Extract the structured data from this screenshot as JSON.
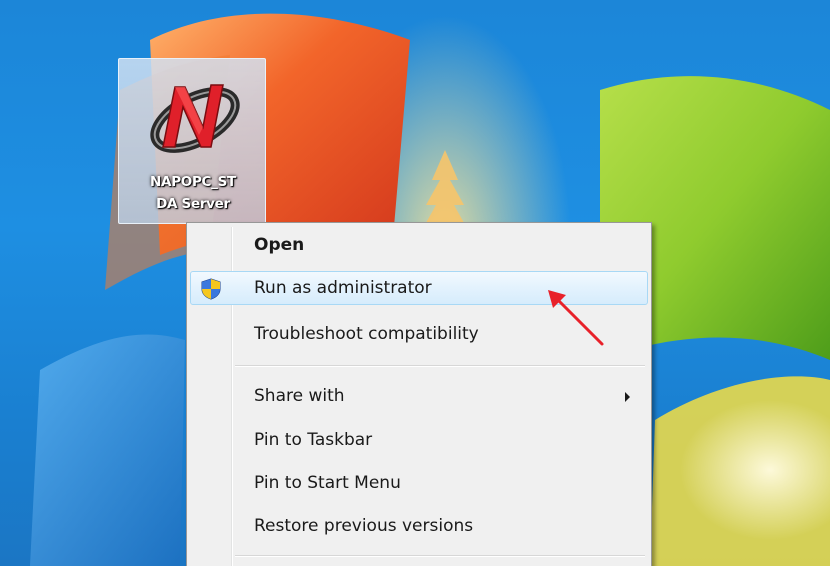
{
  "desktop_icon": {
    "label_line1": "NAPOPC_ST",
    "label_line2": "DA Server",
    "icon": "napopc-app-icon"
  },
  "context_menu": {
    "items": [
      {
        "label": "Open",
        "bold": true
      },
      {
        "label": "Run as administrator",
        "icon": "uac-shield-icon",
        "highlighted": true
      },
      {
        "label": "Troubleshoot compatibility"
      },
      {
        "label": "Share with",
        "has_submenu": true
      },
      {
        "label": "Pin to Taskbar"
      },
      {
        "label": "Pin to Start Menu"
      },
      {
        "label": "Restore previous versions"
      }
    ]
  },
  "annotation": {
    "icon": "red-arrow-icon",
    "color": "#e8212a"
  },
  "colors": {
    "desktop_blue": "#1e8fe2",
    "menu_bg": "#f0f0f0",
    "highlight_border": "#a8d8f5"
  }
}
